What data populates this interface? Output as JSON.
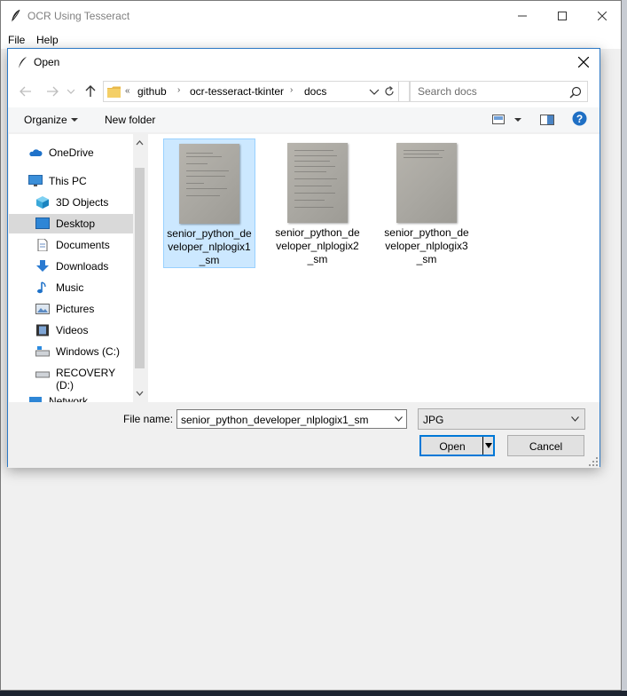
{
  "app": {
    "title": "OCR Using Tesseract",
    "menu": [
      "File",
      "Help"
    ]
  },
  "dialog": {
    "title": "Open",
    "breadcrumb": {
      "prefix": "«",
      "parts": [
        "github",
        "ocr-tesseract-tkinter",
        "docs"
      ]
    },
    "search_placeholder": "Search docs",
    "toolbar": {
      "organize": "Organize",
      "new_folder": "New folder"
    },
    "sidebar": [
      {
        "label": "OneDrive",
        "icon": "cloud-icon"
      },
      {
        "label": "This PC",
        "icon": "computer-icon"
      },
      {
        "label": "3D Objects",
        "icon": "cube-icon"
      },
      {
        "label": "Desktop",
        "icon": "desktop-icon",
        "selected": true
      },
      {
        "label": "Documents",
        "icon": "document-icon"
      },
      {
        "label": "Downloads",
        "icon": "download-icon"
      },
      {
        "label": "Music",
        "icon": "music-icon"
      },
      {
        "label": "Pictures",
        "icon": "pictures-icon"
      },
      {
        "label": "Videos",
        "icon": "videos-icon"
      },
      {
        "label": "Windows (C:)",
        "icon": "drive-icon"
      },
      {
        "label": "RECOVERY (D:)",
        "icon": "drive-icon"
      },
      {
        "label": "Network",
        "icon": "network-icon"
      }
    ],
    "files": [
      {
        "name": "senior_python_developer_nlplogix1_sm",
        "selected": true
      },
      {
        "name": "senior_python_developer_nlplogix2_sm"
      },
      {
        "name": "senior_python_developer_nlplogix3_sm"
      }
    ],
    "file_name_label": "File name:",
    "file_name_value": "senior_python_developer_nlplogix1_sm",
    "file_type": "JPG",
    "open_label": "Open",
    "cancel_label": "Cancel"
  },
  "colors": {
    "accent": "#0078d7",
    "selected_file": "#cce8ff",
    "selected_nav": "#d9d9d9"
  }
}
